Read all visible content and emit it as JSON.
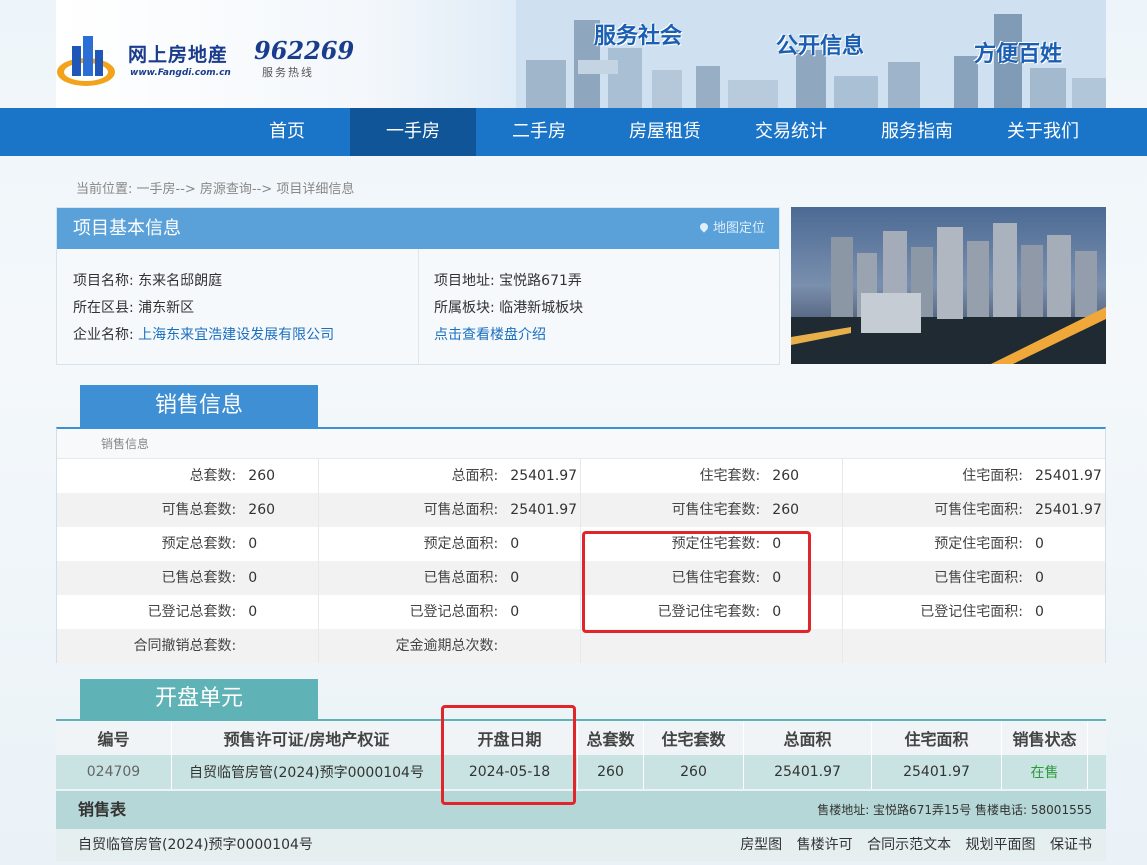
{
  "header": {
    "logo_text": "网上房地産",
    "logo_url": "www.Fangdi.com.cn",
    "hotline_number": "962269",
    "hotline_label": "服务热线",
    "slogans": [
      "服务社会",
      "公开信息",
      "方便百姓"
    ]
  },
  "nav": {
    "items": [
      "首页",
      "一手房",
      "二手房",
      "房屋租赁",
      "交易统计",
      "服务指南",
      "关于我们"
    ],
    "active": "一手房"
  },
  "breadcrumb": "当前位置:  一手房--> 房源查询--> 项目详细信息",
  "project": {
    "title": "项目基本信息",
    "map_link": "地图定位",
    "name_label": "项目名称:",
    "name": "东来名邸朗庭",
    "district_label": "所在区县:",
    "district": "浦东新区",
    "company_label": "企业名称:",
    "company": "上海东来宜浩建设发展有限公司",
    "address_label": "项目地址:",
    "address": "宝悦路671弄",
    "block_label": "所属板块:",
    "block": "临港新城板块",
    "intro_link": "点击查看楼盘介绍"
  },
  "sales": {
    "tab_label": "销售信息",
    "sub_label": "销售信息",
    "rows": [
      [
        [
          "总套数:",
          "260"
        ],
        [
          "总面积:",
          "25401.97"
        ],
        [
          "住宅套数:",
          "260"
        ],
        [
          "住宅面积:",
          "25401.97"
        ]
      ],
      [
        [
          "可售总套数:",
          "260"
        ],
        [
          "可售总面积:",
          "25401.97"
        ],
        [
          "可售住宅套数:",
          "260"
        ],
        [
          "可售住宅面积:",
          "25401.97"
        ]
      ],
      [
        [
          "预定总套数:",
          "0"
        ],
        [
          "预定总面积:",
          "0"
        ],
        [
          "预定住宅套数:",
          "0"
        ],
        [
          "预定住宅面积:",
          "0"
        ]
      ],
      [
        [
          "已售总套数:",
          "0"
        ],
        [
          "已售总面积:",
          "0"
        ],
        [
          "已售住宅套数:",
          "0"
        ],
        [
          "已售住宅面积:",
          "0"
        ]
      ],
      [
        [
          "已登记总套数:",
          "0"
        ],
        [
          "已登记总面积:",
          "0"
        ],
        [
          "已登记住宅套数:",
          "0"
        ],
        [
          "已登记住宅面积:",
          "0"
        ]
      ],
      [
        [
          "合同撤销总套数:",
          ""
        ],
        [
          "定金逾期总次数:",
          ""
        ],
        [
          "",
          ""
        ],
        [
          "",
          ""
        ]
      ]
    ]
  },
  "open_units": {
    "tab_label": "开盘单元",
    "headers": [
      "编号",
      "预售许可证/房地产权证",
      "开盘日期",
      "总套数",
      "住宅套数",
      "总面积",
      "住宅面积",
      "销售状态"
    ],
    "rows": [
      [
        "024709",
        "自贸临管房管(2024)预字0000104号",
        "2024-05-18",
        "260",
        "260",
        "25401.97",
        "25401.97",
        "在售"
      ]
    ]
  },
  "sales_table": {
    "title": "销售表",
    "info": "售楼地址: 宝悦路671弄15号 售楼电话: 58001555",
    "permit": "自贸临管房管(2024)预字0000104号",
    "links": [
      "房型图",
      "售楼许可",
      "合同示范文本",
      "规划平面图",
      "保证书"
    ]
  },
  "colors": {
    "nav_bg": "#1a74c7",
    "nav_active": "#0f5598",
    "sales_tab": "#3f8fd4",
    "units_tab": "#5fb2b5",
    "annotation_red": "#e0262b"
  }
}
